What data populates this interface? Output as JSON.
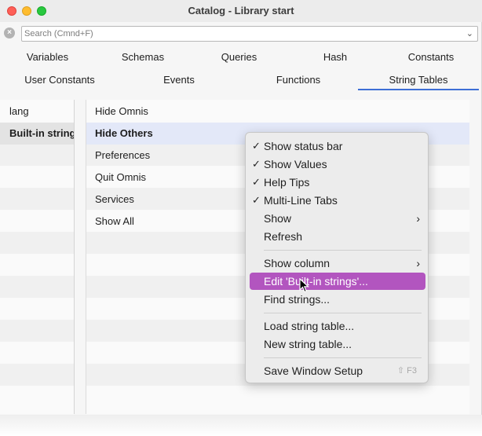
{
  "window": {
    "title": "Catalog - Library start"
  },
  "search": {
    "placeholder": "Search (Cmnd+F)",
    "value": ""
  },
  "tabs_row1": [
    "Variables",
    "Schemas",
    "Queries",
    "Hash",
    "Constants"
  ],
  "tabs_row2": [
    "User Constants",
    "Events",
    "Functions",
    "String Tables"
  ],
  "active_tab": "String Tables",
  "left_list": {
    "items": [
      "lang",
      "Built-in strings"
    ],
    "selected": "Built-in strings"
  },
  "right_list": {
    "items": [
      "Hide Omnis",
      "Hide Others",
      "Preferences",
      "Quit Omnis",
      "Services",
      "Show All"
    ],
    "selected": "Hide Others"
  },
  "context_menu": {
    "items": [
      {
        "label": "Show status bar",
        "checked": true
      },
      {
        "label": "Show Values",
        "checked": true
      },
      {
        "label": "Help Tips",
        "checked": true
      },
      {
        "label": "Multi-Line Tabs",
        "checked": true
      },
      {
        "label": "Show",
        "submenu": true
      },
      {
        "label": "Refresh"
      },
      {
        "label": "Show column",
        "submenu": true
      },
      {
        "label": "Edit 'Built-in strings'...",
        "highlighted": true
      },
      {
        "label": "Find strings..."
      },
      {
        "label": "Load string table..."
      },
      {
        "label": "New string table..."
      },
      {
        "label": "Save Window Setup",
        "shortcut": "⇧ F3"
      }
    ],
    "check_glyph": "✓",
    "submenu_glyph": "›",
    "highlight_color": "#b255bf"
  },
  "colors": {
    "tab_underline": "#3d6fd6",
    "selected_row": "#e3e8f8"
  }
}
